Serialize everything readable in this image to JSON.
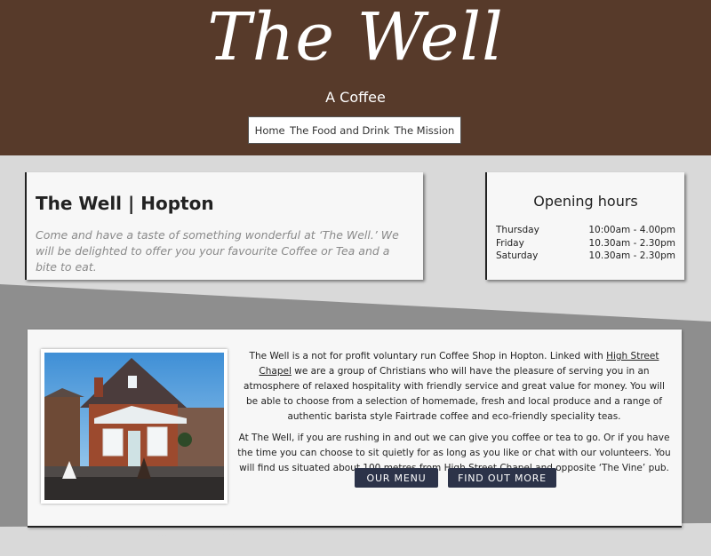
{
  "header": {
    "title": "The Well",
    "tagline": "A Coffee"
  },
  "nav": {
    "items": [
      {
        "label": "Home"
      },
      {
        "label": "The Food and Drink"
      },
      {
        "label": "The Mission"
      }
    ]
  },
  "intro": {
    "title": "The Well | Hopton",
    "text": "Come and have a taste of something wonderful at ‘The Well.’ We will be delighted to offer you your favourite Coffee or Tea and a bite to eat."
  },
  "hours": {
    "title": "Opening hours",
    "rows": [
      {
        "day": "Thursday",
        "time": "10:00am - 4.00pm"
      },
      {
        "day": "Friday",
        "time": "10.30am - 2.30pm"
      },
      {
        "day": "Saturday",
        "time": "10.30am - 2.30pm"
      }
    ]
  },
  "main": {
    "p1_before": "The Well is a not for profit voluntary run Coffee Shop in Hopton. Linked with ",
    "p1_link": "High Street Chapel",
    "p1_after": " we are a group of Christians who will have the pleasure of serving you in an atmosphere of relaxed hospitality with friendly service and great value for money. You will be able to choose from a selection of homemade, fresh and local produce and a range of authentic barista style Fairtrade coffee and eco-friendly speciality teas.",
    "p2": "At The Well, if you are rushing in and out we can give you coffee or tea to go. Or if you have the time you can choose to sit quietly for as long as you like or chat with our volunteers. You will find us situated about 100 metres from High Street Chapel and opposite ‘The Vine’ pub.",
    "btn_menu": "OUR MENU",
    "btn_more": "FIND OUT MORE"
  },
  "colors": {
    "header_bg": "#573a2a",
    "band_dark": "#8e8e8e",
    "band_light": "#d9d9d9",
    "button_bg": "#2c3349"
  }
}
